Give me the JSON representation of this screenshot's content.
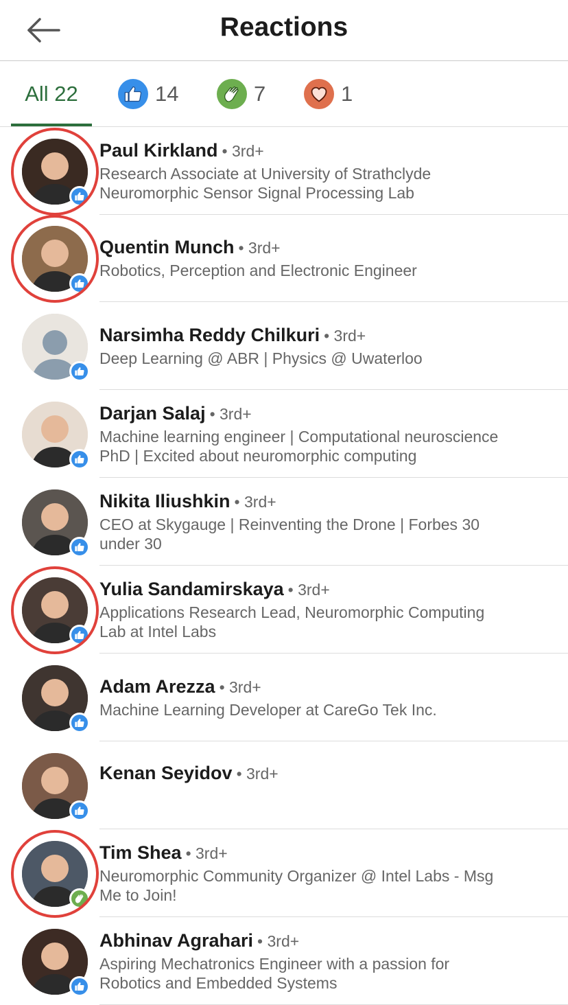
{
  "header": {
    "title": "Reactions"
  },
  "tabs": {
    "all": "All 22",
    "like_count": "14",
    "clap_count": "7",
    "love_count": "1"
  },
  "colors": {
    "accent": "#2c6e3c",
    "like": "#378fe9",
    "clap": "#6dae4f",
    "love": "#df704d",
    "highlight_ring": "#e0413b"
  },
  "people": [
    {
      "name": "Paul Kirkland",
      "degree": "• 3rd+",
      "line1": "Research Associate at University of Strathclyde",
      "line2": "Neuromorphic Sensor Signal Processing Lab",
      "reaction": "like-icon",
      "circled": true
    },
    {
      "name": "Quentin Munch",
      "degree": "• 3rd+",
      "line1": "Robotics, Perception and Electronic Engineer",
      "line2": "",
      "reaction": "like-icon",
      "circled": true
    },
    {
      "name": "Narsimha Reddy Chilkuri",
      "degree": "• 3rd+",
      "line1": "Deep Learning @ ABR | Physics @ Uwaterloo",
      "line2": "",
      "reaction": "like-icon",
      "circled": false
    },
    {
      "name": "Darjan Salaj",
      "degree": "• 3rd+",
      "line1": "Machine learning engineer | Computational neuroscience",
      "line2": "PhD | Excited about neuromorphic computing",
      "reaction": "like-icon",
      "circled": false
    },
    {
      "name": "Nikita Iliushkin",
      "degree": "• 3rd+",
      "line1": "CEO at Skygauge | Reinventing the Drone | Forbes 30",
      "line2": "under 30",
      "reaction": "like-icon",
      "circled": false
    },
    {
      "name": "Yulia Sandamirskaya",
      "degree": "• 3rd+",
      "line1": "Applications Research Lead, Neuromorphic Computing",
      "line2": "Lab at Intel Labs",
      "reaction": "like-icon",
      "circled": true
    },
    {
      "name": "Adam Arezza",
      "degree": "• 3rd+",
      "line1": "Machine Learning Developer at CareGo Tek Inc.",
      "line2": "",
      "reaction": "like-icon",
      "circled": false
    },
    {
      "name": "Kenan Seyidov",
      "degree": "• 3rd+",
      "line1": "",
      "line2": "",
      "reaction": "like-icon",
      "circled": false
    },
    {
      "name": "Tim Shea",
      "degree": "• 3rd+",
      "line1": "Neuromorphic Community Organizer @ Intel Labs - Msg",
      "line2": "Me to Join!",
      "reaction": "clap-icon",
      "circled": true
    },
    {
      "name": "Abhinav Agrahari",
      "degree": "• 3rd+",
      "line1": "Aspiring Mechatronics Engineer with a passion for",
      "line2": "Robotics and Embedded Systems",
      "reaction": "like-icon",
      "circled": false
    }
  ]
}
